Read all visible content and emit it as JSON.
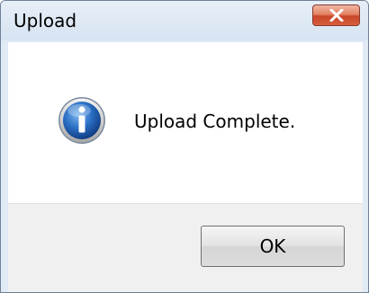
{
  "window": {
    "title": "Upload",
    "close_icon": "close-x-icon"
  },
  "dialog": {
    "icon": "information-icon",
    "message": "Upload Complete.",
    "ok_label": "OK"
  },
  "colors": {
    "close_button": "#d65f3c",
    "info_icon": "#1e5fae",
    "titlebar": "#dfeaf5"
  }
}
